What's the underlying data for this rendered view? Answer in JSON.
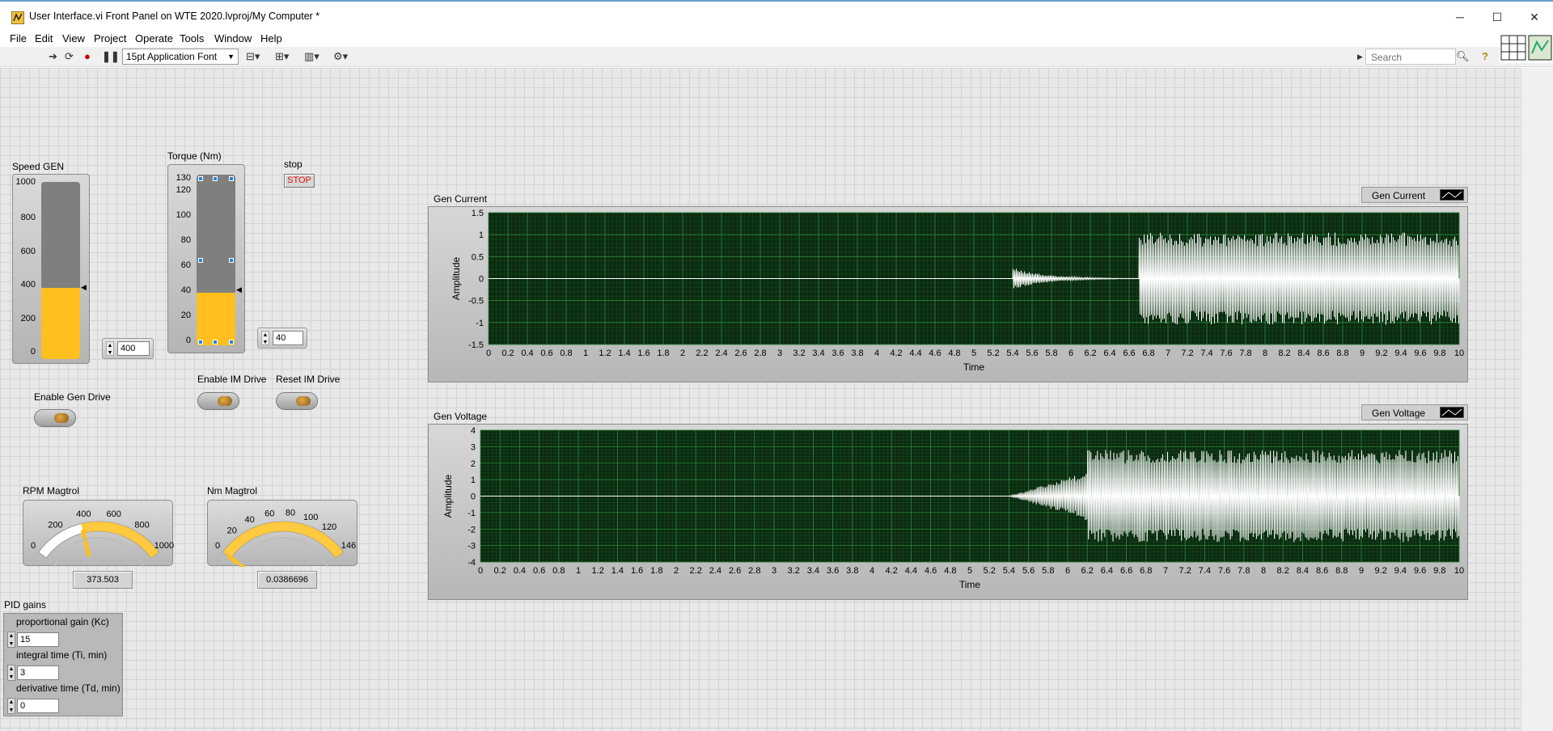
{
  "window": {
    "title": "User Interface.vi Front Panel on WTE 2020.lvproj/My Computer *",
    "controls": [
      "─",
      "☐",
      "✕"
    ]
  },
  "menu": [
    "File",
    "Edit",
    "View",
    "Project",
    "Operate",
    "Tools",
    "Window",
    "Help"
  ],
  "toolbar": {
    "font": "15pt Application Font",
    "search_placeholder": "Search"
  },
  "speed_gen": {
    "label": "Speed  GEN",
    "ticks": [
      "1000",
      "800",
      "600",
      "400",
      "200",
      "0"
    ],
    "max": 1000,
    "value": 400,
    "value_text": "400"
  },
  "torque": {
    "label": "Torque (Nm)",
    "ticks": [
      "130",
      "120",
      "100",
      "80",
      "60",
      "40",
      "20",
      "0"
    ],
    "max": 130,
    "value": 40,
    "value_text": "40"
  },
  "stop": {
    "label": "stop",
    "button": "STOP"
  },
  "buttons": {
    "enable_gen": "Enable Gen Drive",
    "enable_im": "Enable IM Drive",
    "reset_im": "Reset IM Drive"
  },
  "rpm_gauge": {
    "label": "RPM Magtrol",
    "ticks": [
      "0",
      "200",
      "400",
      "600",
      "800",
      "1000"
    ],
    "min": 0,
    "max": 1000,
    "value": 373.503,
    "readout": "373.503"
  },
  "nm_gauge": {
    "label": "Nm Magtrol",
    "ticks": [
      "0",
      "20",
      "40",
      "60",
      "80",
      "100",
      "120",
      "146"
    ],
    "min": 0,
    "max": 146,
    "value": 0.0386696,
    "readout": "0.0386696"
  },
  "pid": {
    "title": "PID gains",
    "kc_label": "proportional gain (Kc)",
    "kc": "15",
    "ti_label": "integral time (Ti, min)",
    "ti": "3",
    "td_label": "derivative time (Td, min)",
    "td": "0"
  },
  "colors": {
    "plot_bg": "#0b2a10",
    "grid_major": "#2c8a3a",
    "grid_minor": "#1a4d22",
    "trace": "#ffffff",
    "gauge_fill": "#ffc01f"
  },
  "chart_data": [
    {
      "type": "line",
      "title": "Gen Current",
      "legend": "Gen Current",
      "xlabel": "Time",
      "ylabel": "Amplitude",
      "xlim": [
        0,
        10
      ],
      "ylim": [
        -1.5,
        1.5
      ],
      "xticks": [
        "0",
        "0.2",
        "0.4",
        "0.6",
        "0.8",
        "1",
        "1.2",
        "1.4",
        "1.6",
        "1.8",
        "2",
        "2.2",
        "2.4",
        "2.6",
        "2.8",
        "3",
        "3.2",
        "3.4",
        "3.6",
        "3.8",
        "4",
        "4.2",
        "4.4",
        "4.6",
        "4.8",
        "5",
        "5.2",
        "5.4",
        "5.6",
        "5.8",
        "6",
        "6.2",
        "6.4",
        "6.6",
        "6.8",
        "7",
        "7.2",
        "7.4",
        "7.6",
        "7.8",
        "8",
        "8.2",
        "8.4",
        "8.6",
        "8.8",
        "9",
        "9.2",
        "9.4",
        "9.6",
        "9.8",
        "10"
      ],
      "yticks": [
        "1.5",
        "1",
        "0.5",
        "0",
        "-0.5",
        "-1",
        "-1.5"
      ],
      "segments": [
        {
          "x_start": 0,
          "x_end": 5.4,
          "amplitude": 0.0
        },
        {
          "x_start": 5.4,
          "x_end": 6.7,
          "amplitude": 0.25,
          "shape": "decaying"
        },
        {
          "x_start": 6.7,
          "x_end": 10,
          "amplitude": 1.05,
          "shape": "oscillating"
        }
      ]
    },
    {
      "type": "line",
      "title": "Gen Voltage",
      "legend": "Gen Voltage",
      "xlabel": "Time",
      "ylabel": "Amplitude",
      "xlim": [
        0,
        10
      ],
      "ylim": [
        -4,
        4
      ],
      "xticks": [
        "0",
        "0.2",
        "0.4",
        "0.6",
        "0.8",
        "1",
        "1.2",
        "1.4",
        "1.6",
        "1.8",
        "2",
        "2.2",
        "2.4",
        "2.6",
        "2.8",
        "3",
        "3.2",
        "3.4",
        "3.6",
        "3.8",
        "4",
        "4.2",
        "4.4",
        "4.6",
        "4.8",
        "5",
        "5.2",
        "5.4",
        "5.6",
        "5.8",
        "6",
        "6.2",
        "6.4",
        "6.6",
        "6.8",
        "7",
        "7.2",
        "7.4",
        "7.6",
        "7.8",
        "8",
        "8.2",
        "8.4",
        "8.6",
        "8.8",
        "9",
        "9.2",
        "9.4",
        "9.6",
        "9.8",
        "10"
      ],
      "yticks": [
        "4",
        "3",
        "2",
        "1",
        "0",
        "-1",
        "-2",
        "-3",
        "-4"
      ],
      "segments": [
        {
          "x_start": 0,
          "x_end": 5.4,
          "amplitude": 0.0
        },
        {
          "x_start": 5.4,
          "x_end": 6.2,
          "amplitude": 1.5,
          "shape": "growing"
        },
        {
          "x_start": 6.2,
          "x_end": 10,
          "amplitude": 2.8,
          "shape": "oscillating"
        }
      ]
    }
  ]
}
